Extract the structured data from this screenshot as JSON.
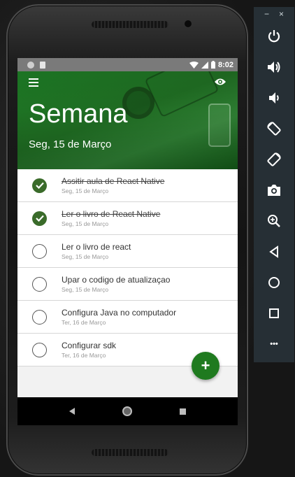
{
  "status_bar": {
    "time": "8:02"
  },
  "header": {
    "title": "Semana",
    "subtitle": "Seg, 15 de Março"
  },
  "tasks": [
    {
      "desc": "Assitir aula de React Native",
      "date": "Seg, 15 de Março",
      "done": true
    },
    {
      "desc": "Ler o livro de React Native",
      "date": "Seg, 15 de Março",
      "done": true
    },
    {
      "desc": "Ler o livro de react",
      "date": "Seg, 15 de Março",
      "done": false
    },
    {
      "desc": "Upar o codigo de atualizaçao",
      "date": "Seg, 15 de Março",
      "done": false
    },
    {
      "desc": "Configura Java no computador",
      "date": "Ter, 16 de Março",
      "done": false
    },
    {
      "desc": "Configurar sdk",
      "date": "Ter, 16 de Março",
      "done": false
    }
  ],
  "fab": {
    "label": "+"
  },
  "emulator": {
    "minimize": "−",
    "close": "×",
    "more": "•••"
  },
  "colors": {
    "accent": "#1f7a1f",
    "check_done": "#3a6b2a",
    "emulator_bg": "#262f35"
  }
}
